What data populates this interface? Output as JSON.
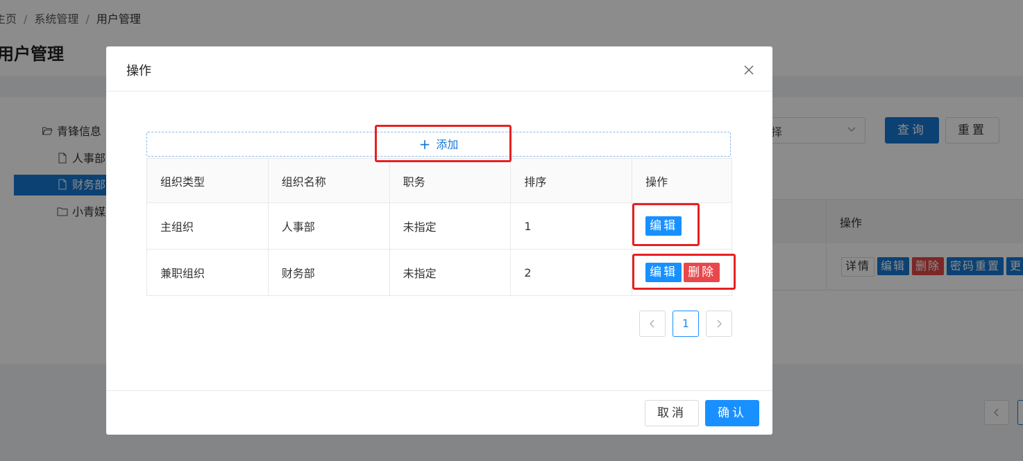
{
  "background": {
    "breadcrumb": [
      "主页",
      "系统管理",
      "用户管理"
    ],
    "page_title": "用户管理",
    "tree": [
      {
        "label": "青锋信息",
        "type": "folder-open"
      },
      {
        "label": "人事部",
        "type": "file"
      },
      {
        "label": "财务部",
        "type": "file",
        "selected": true
      },
      {
        "label": "小青媒",
        "type": "folder"
      }
    ],
    "select_value": "择",
    "query_button": "查询",
    "reset_button": "重置",
    "table_header": "操作",
    "row_actions": [
      "详情",
      "编辑",
      "删除",
      "密码重置",
      "更"
    ]
  },
  "modal": {
    "title": "操作",
    "add_button": "添加",
    "columns": [
      "组织类型",
      "组织名称",
      "职务",
      "排序",
      "操作"
    ],
    "rows": [
      {
        "type": "主组织",
        "name": "人事部",
        "position": "未指定",
        "order": "1",
        "actions": [
          "编辑"
        ]
      },
      {
        "type": "兼职组织",
        "name": "财务部",
        "position": "未指定",
        "order": "2",
        "actions": [
          "编辑",
          "删除"
        ]
      }
    ],
    "pagination": {
      "current": "1"
    },
    "cancel_button": "取消",
    "ok_button": "确认"
  },
  "colors": {
    "primary": "#1890ff",
    "danger": "#e8474b",
    "highlight": "#e62020"
  }
}
